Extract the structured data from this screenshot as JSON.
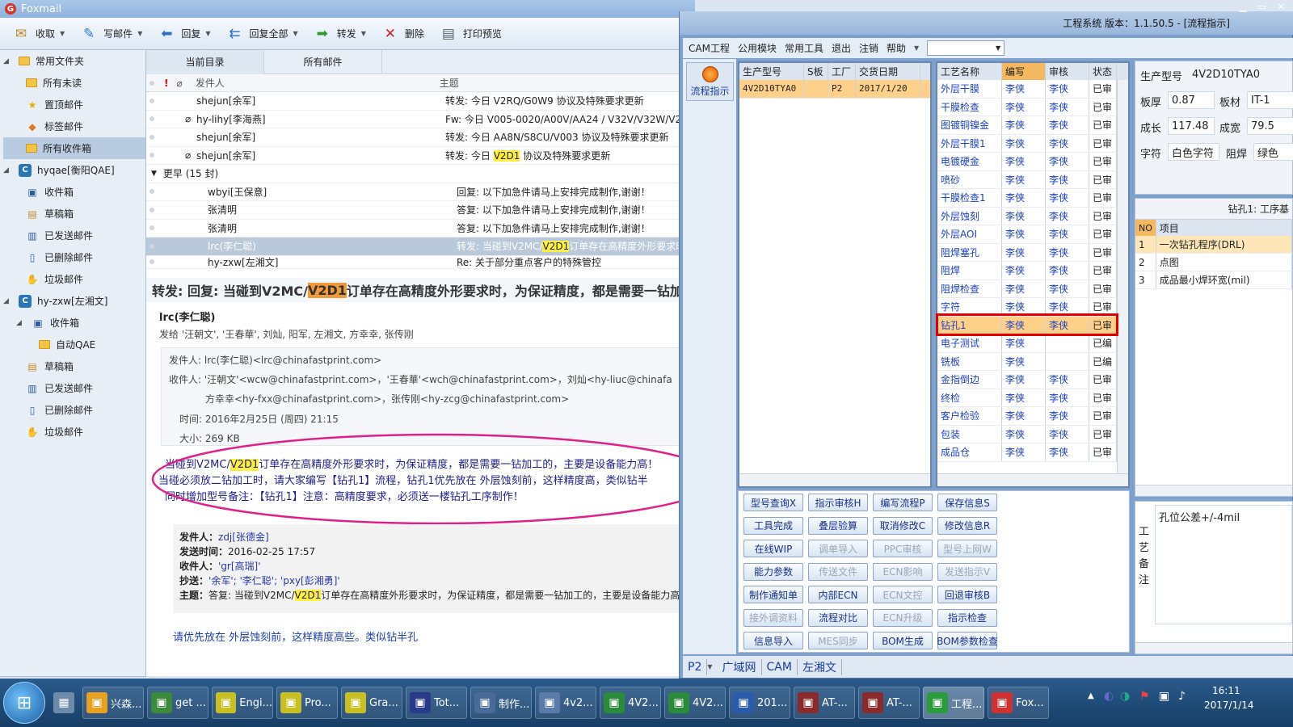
{
  "foxmail": {
    "app_title": "Foxmail",
    "toolbar": [
      {
        "label": "收取",
        "icon": "inbox-tray-icon"
      },
      {
        "label": "写邮件",
        "icon": "pen-icon"
      },
      {
        "label": "回复",
        "icon": "reply-icon"
      },
      {
        "label": "回复全部",
        "icon": "reply-all-icon"
      },
      {
        "label": "转发",
        "icon": "forward-icon"
      },
      {
        "label": "删除",
        "icon": "delete-icon"
      },
      {
        "label": "打印预览",
        "icon": "print-icon"
      }
    ],
    "sidebar": {
      "common_group": "常用文件夹",
      "common": [
        "所有未读",
        "置顶邮件",
        "标签邮件",
        "所有收件箱"
      ],
      "account1": "hyqae[衡阳QAE]",
      "account1_folders": [
        "收件箱",
        "草稿箱",
        "已发送邮件",
        "已删除邮件",
        "垃圾邮件"
      ],
      "account2": "hy-zxw[左湘文]",
      "account2_folders": [
        "收件箱",
        "自动QAE",
        "草稿箱",
        "已发送邮件",
        "已删除邮件",
        "垃圾邮件"
      ]
    },
    "tabs": [
      "当前目录",
      "所有邮件"
    ],
    "columns": {
      "sender": "发件人",
      "subject": "主题"
    },
    "group_earlier": "更早 (15 封)",
    "messages": [
      {
        "sender": "shejun[余军]",
        "subject": "转发: 今日 V2RQ/G0W9  协议及特殊要求更新",
        "attach": false
      },
      {
        "sender": "hy-lihy[李海燕]",
        "subject": "Fw: 今日 V005-0020/A00V/AA24 / V32V/V32W/V2",
        "attach": true
      },
      {
        "sender": "shejun[余军]",
        "subject": "转发: 今日 AA8N/S8CU/V003  协议及特殊要求更新",
        "attach": false
      },
      {
        "sender": "shejun[余军]",
        "subject_pre": "转发: 今日 ",
        "subject_hl": "V2D1",
        "subject_post": "  协议及特殊要求更新",
        "attach": true
      },
      {
        "sender": "wbyi[王保意]",
        "subject": "回复: 以下加急件请马上安排完成制作,谢谢！",
        "attach": false
      },
      {
        "sender": "张清明",
        "subject": "答复: 以下加急件请马上安排完成制作,谢谢！",
        "attach": false
      },
      {
        "sender": "张清明",
        "subject": "答复: 以下加急件请马上安排完成制作,谢谢！",
        "attach": false
      },
      {
        "sender": "lrc(李仁聪)",
        "subject_pre": "转发: 当碰到V2MC/",
        "subject_hl": "V2D1",
        "subject_post": "订单存在高精度外形要求时",
        "attach": false,
        "selected": true
      },
      {
        "sender": "hy-zxw[左湘文]",
        "subject": "Re: 关于部分重点客户的特殊管控",
        "attach": false
      }
    ],
    "preview": {
      "title_pre": "转发: 回复: 当碰到V2MC/",
      "title_hl": "V2D1",
      "title_post": "订单存在高精度外形要求时，为保证精度，都是需要一钻加工",
      "from_name": "lrc(李仁聪)",
      "sent_to": "发给 '汪朝文', '王春華', 刘灿, 阳军, 左湘文, 方幸幸, 张传刚",
      "meta_from": "发件人: lrc(李仁聪)<lrc@chinafastprint.com>",
      "meta_to": "收件人: '汪朝文'<wcw@chinafastprint.com>，'王春華'<wch@chinafastprint.com>，刘灿<hy-liuc@chinafa",
      "meta_to2": "方幸幸<hy-fxx@chinafastprint.com>，张传刚<hy-zcg@chinafastprint.com>",
      "meta_time": "时间: 2016年2月25日 (周四) 21:15",
      "meta_size": "大小: 269 KB",
      "body1_pre": "当碰到V2MC/",
      "body1_hl": "V2D1",
      "body1_post": "订单存在高精度外形要求时，为保证精度，都是需要一钻加工的，主要是设备能力高！",
      "body2": "当碰必须放二钻加工时，请大家编写【钻孔1】流程，钻孔1优先放在 外层蚀刻前，这样精度高，类似钻半",
      "body3": "同时增加型号备注：【钻孔1】注意：高精度要求，必须送一楼钻孔工序制作！",
      "quote": {
        "from_label": "发件人：",
        "from": "zdj[张德金]",
        "time_label": "发送时间：",
        "time": "2016-02-25 17:57",
        "to_label": "收件人：",
        "to": "'gr[高瑞]'",
        "cc_label": "抄送：",
        "cc": "'余军'; '李仁聪'; 'pxy[彭湘勇]'",
        "subj_label": "主题：",
        "subj_pre": "答复: 当碰到V2MC/",
        "subj_hl": "V2D1",
        "subj_post": "订单存在高精度外形要求时，为保证精度，都是需要一钻加工的，主要是设备能力高!"
      },
      "reply": "请优先放在 外层蚀刻前，这样精度高些。类似钻半孔"
    }
  },
  "cam": {
    "title": "工程系统   版本：1.1.50.5 - [流程指示]",
    "menu": [
      "CAM工程",
      "公用模块",
      "常用工具",
      "退出",
      "注销",
      "帮助"
    ],
    "flow_btn": "流程指示",
    "order_cols": [
      "生产型号",
      "S板",
      "工厂",
      "交货日期"
    ],
    "order_row": {
      "model": "4V2D10TYA0",
      "s": "",
      "factory": "P2",
      "date": "2017/1/20"
    },
    "proc_cols": [
      "工艺名称",
      "编写",
      "审核",
      "状态"
    ],
    "processes": [
      [
        "外层干膜",
        "李侠",
        "李侠",
        "已审"
      ],
      [
        "干膜检查",
        "李侠",
        "李侠",
        "已审"
      ],
      [
        "图镀铜镍金",
        "李侠",
        "李侠",
        "已审"
      ],
      [
        "外层干膜1",
        "李侠",
        "李侠",
        "已审"
      ],
      [
        "电镀硬金",
        "李侠",
        "李侠",
        "已审"
      ],
      [
        "喷砂",
        "李侠",
        "李侠",
        "已审"
      ],
      [
        "干膜检查1",
        "李侠",
        "李侠",
        "已审"
      ],
      [
        "外层蚀刻",
        "李侠",
        "李侠",
        "已审"
      ],
      [
        "外层AOI",
        "李侠",
        "李侠",
        "已审"
      ],
      [
        "阻焊塞孔",
        "李侠",
        "李侠",
        "已审"
      ],
      [
        "阻焊",
        "李侠",
        "李侠",
        "已审"
      ],
      [
        "阻焊检查",
        "李侠",
        "李侠",
        "已审"
      ],
      [
        "字符",
        "李侠",
        "李侠",
        "已审"
      ],
      [
        "钻孔1",
        "李侠",
        "李侠",
        "已审"
      ],
      [
        "电子测试",
        "李侠",
        "",
        "已编"
      ],
      [
        "铣板",
        "李侠",
        "",
        "已编"
      ],
      [
        "金指倒边",
        "李侠",
        "李侠",
        "已审"
      ],
      [
        "终检",
        "李侠",
        "李侠",
        "已审"
      ],
      [
        "客户检验",
        "李侠",
        "李侠",
        "已审"
      ],
      [
        "包装",
        "李侠",
        "李侠",
        "已审"
      ],
      [
        "成品仓",
        "李侠",
        "李侠",
        "已审"
      ]
    ],
    "buttons": [
      [
        "型号查询X",
        "指示审核H",
        "编写流程P",
        "保存信息S"
      ],
      [
        "工具完成",
        "叠层验算",
        "取消修改C",
        "修改信息R"
      ],
      [
        "在线WIP",
        "调单导入",
        "PPC审核",
        "型号上网W"
      ],
      [
        "能力参数",
        "传送文件",
        "ECN影响",
        "发送指示V"
      ],
      [
        "制作通知单",
        "内部ECN",
        "ECN文控",
        "回退审核B"
      ],
      [
        "接外调资料",
        "流程对比",
        "ECN升级",
        "指示检查"
      ],
      [
        "信息导入",
        "MES同步",
        "BOM生成",
        "BOM参数检查"
      ]
    ],
    "disabled_buttons": [
      "调单导入",
      "PPC审核",
      "型号上网W",
      "传送文件",
      "ECN影响",
      "发送指示V",
      "ECN文控",
      "接外调资料",
      "ECN升级",
      "MES同步"
    ],
    "info": {
      "model_label": "生产型号",
      "model": "4V2D10TYA0",
      "thick_label": "板厚",
      "thick": "0.87",
      "mat_label": "板材",
      "mat": "IT-1",
      "grow_label": "成长",
      "grow": "117.48",
      "wid_label": "成宽",
      "wid": "79.5",
      "char_label": "字符",
      "char": "白色字符",
      "sm_label": "阻焊",
      "sm": "绿色"
    },
    "proc_title": "钻孔1: 工序基",
    "proc_items_cols": [
      "NO",
      "项目"
    ],
    "proc_items": [
      [
        "1",
        "一次钻孔程序(DRL)"
      ],
      [
        "2",
        "点图"
      ],
      [
        "3",
        "成品最小焊环宽(mil)"
      ]
    ],
    "note_label": "工艺备注",
    "note_text": "孔位公差+/-4mil",
    "status": [
      "P2",
      "广域网",
      "CAM",
      "左湘文"
    ]
  },
  "taskbar": {
    "items": [
      "兴森...",
      "get ...",
      "Engi...",
      "Pro...",
      "Gra...",
      "Tot...",
      "制作...",
      "4v2...",
      "4V2...",
      "4V2...",
      "201...",
      "AT-...",
      "AT-...",
      "工程...",
      "Fox..."
    ],
    "time": "16:11",
    "date": "2017/1/14"
  }
}
